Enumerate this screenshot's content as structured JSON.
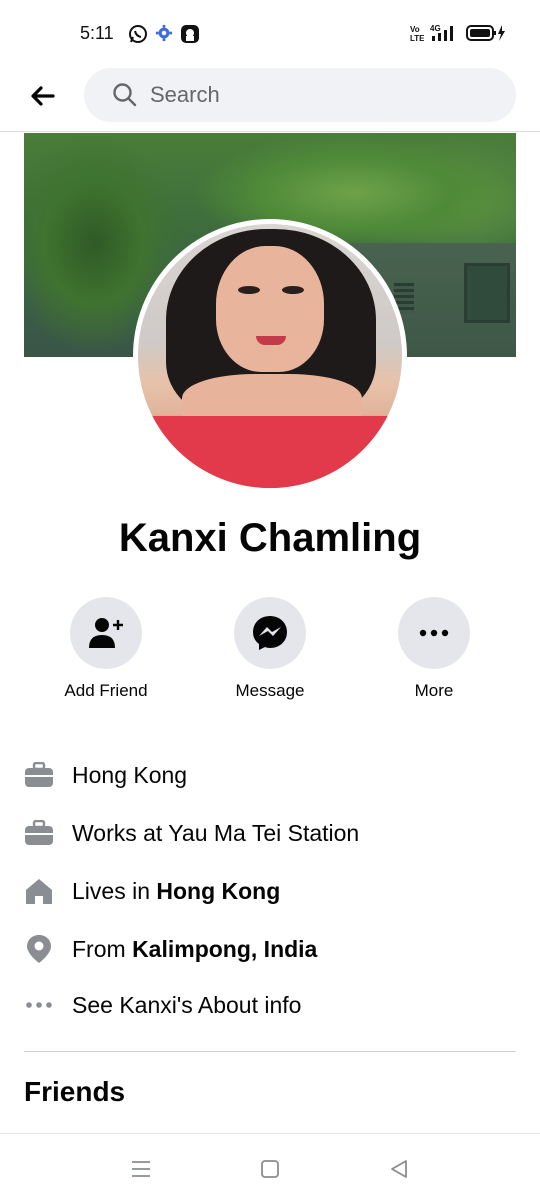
{
  "status_bar": {
    "time": "5:11",
    "icons": [
      "whatsapp-icon",
      "gear-icon",
      "notification-icon",
      "volte-icon",
      "4g-signal-icon",
      "battery-charging-icon"
    ]
  },
  "top_bar": {
    "search_placeholder": "Search"
  },
  "profile": {
    "name": "Kanxi Chamling"
  },
  "actions": [
    {
      "label": "Add Friend",
      "icon": "add-friend-icon"
    },
    {
      "label": "Message",
      "icon": "messenger-icon"
    },
    {
      "label": "More",
      "icon": "more-icon"
    }
  ],
  "info": [
    {
      "icon": "briefcase-icon",
      "prefix": "Hong Kong",
      "bold": ""
    },
    {
      "icon": "briefcase-icon",
      "prefix": "Works at Yau Ma Tei Station",
      "bold": ""
    },
    {
      "icon": "home-icon",
      "prefix": "Lives in ",
      "bold": "Hong Kong"
    },
    {
      "icon": "location-pin-icon",
      "prefix": "From ",
      "bold": "Kalimpong, India"
    },
    {
      "icon": "more-dots-icon",
      "prefix": "See Kanxi's About info",
      "bold": ""
    }
  ],
  "friends_title": "Friends",
  "colors": {
    "icon_gray": "#8a8d91",
    "search_bg": "#f0f2f5",
    "action_bg": "#e4e6eb",
    "messenger_dark": "#050505"
  }
}
